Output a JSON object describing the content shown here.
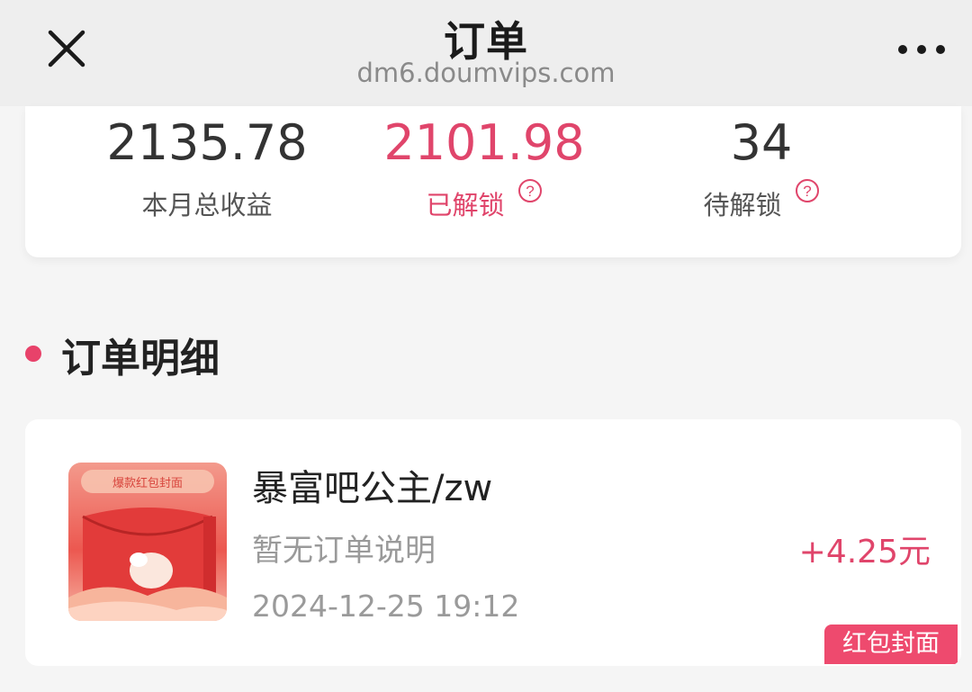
{
  "header": {
    "title": "订单",
    "url": "dm6.doumvips.com"
  },
  "stats": [
    {
      "value": "2135.78",
      "label": "本月总收益"
    },
    {
      "value": "2101.98",
      "label": "已解锁"
    },
    {
      "value": "34",
      "label": "待解锁"
    }
  ],
  "section": {
    "title": "订单明细"
  },
  "order": {
    "name": "暴富吧公主/zw",
    "description": "暂无订单说明",
    "time": "2024-12-25 19:12",
    "amount": "+4.25元",
    "tag": "红包封面",
    "thumb_caption": "爆款红包封面"
  },
  "colors": {
    "accent": "#e0456b",
    "topbar": "#eeeeee",
    "background": "#f5f5f5"
  },
  "icons": [
    "close-icon",
    "more-icon",
    "help-icon"
  ]
}
